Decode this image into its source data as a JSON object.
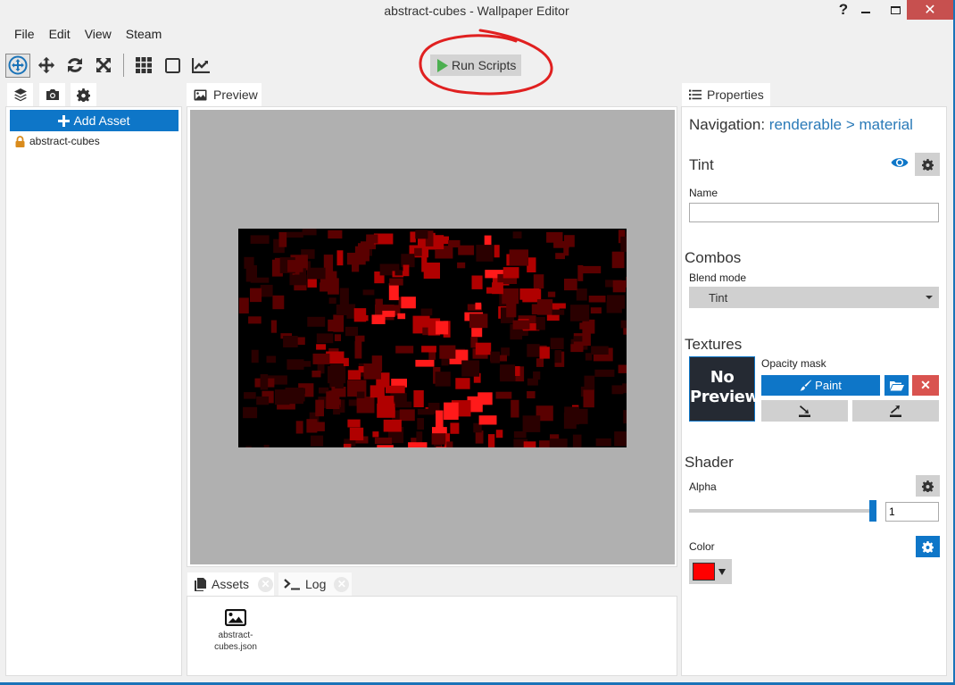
{
  "window": {
    "title": "abstract-cubes - Wallpaper Editor",
    "help_label": "?",
    "close_label": "✕"
  },
  "menu": {
    "items": [
      "File",
      "Edit",
      "View",
      "Steam"
    ]
  },
  "toolbar": {
    "tools": [
      {
        "icon": "select-move-icon",
        "active": true
      },
      {
        "icon": "move-arrows-icon",
        "active": false
      },
      {
        "icon": "rotate-icon",
        "active": false
      },
      {
        "icon": "scale-icon",
        "active": false
      },
      {
        "icon": "grid-icon",
        "active": false
      },
      {
        "icon": "square-icon",
        "active": false
      },
      {
        "icon": "chart-line-icon",
        "active": false
      }
    ],
    "run_scripts_label": "Run Scripts",
    "annotation_color": "#e02020"
  },
  "left_panel": {
    "tabs": [
      {
        "icon": "layers-icon",
        "active": true
      },
      {
        "icon": "camera-icon",
        "active": false
      },
      {
        "icon": "gear-icon",
        "active": false
      }
    ],
    "add_asset_label": "Add Asset",
    "tree": [
      {
        "label": "abstract-cubes",
        "icon": "lock-icon"
      }
    ]
  },
  "preview": {
    "tab_label": "Preview",
    "image_description": "abstract red cubes on black"
  },
  "bottom_panel": {
    "tabs": [
      {
        "label": "Assets",
        "icon": "files-icon",
        "active": true
      },
      {
        "label": "Log",
        "icon": "terminal-icon",
        "active": false
      }
    ],
    "assets": [
      {
        "line1": "abstract-",
        "line2": "cubes.json",
        "icon": "image-icon"
      }
    ]
  },
  "properties": {
    "tab_label": "Properties",
    "navigation_label": "Navigation:",
    "navigation_path": [
      "renderable",
      "material"
    ],
    "navigation_separator": ">",
    "tint": {
      "title": "Tint",
      "name_label": "Name",
      "name_value": ""
    },
    "combos": {
      "title": "Combos",
      "blend_mode_label": "Blend mode",
      "blend_mode_value": "Tint"
    },
    "textures": {
      "title": "Textures",
      "no_preview_line1": "No",
      "no_preview_line2": "Preview",
      "opacity_mask_label": "Opacity mask",
      "paint_label": "Paint"
    },
    "shader": {
      "title": "Shader",
      "alpha_label": "Alpha",
      "alpha_value": "1",
      "alpha_fraction": 1.0,
      "color_label": "Color",
      "color_value": "#ff0000"
    },
    "accent_color": "#0e76c8"
  }
}
